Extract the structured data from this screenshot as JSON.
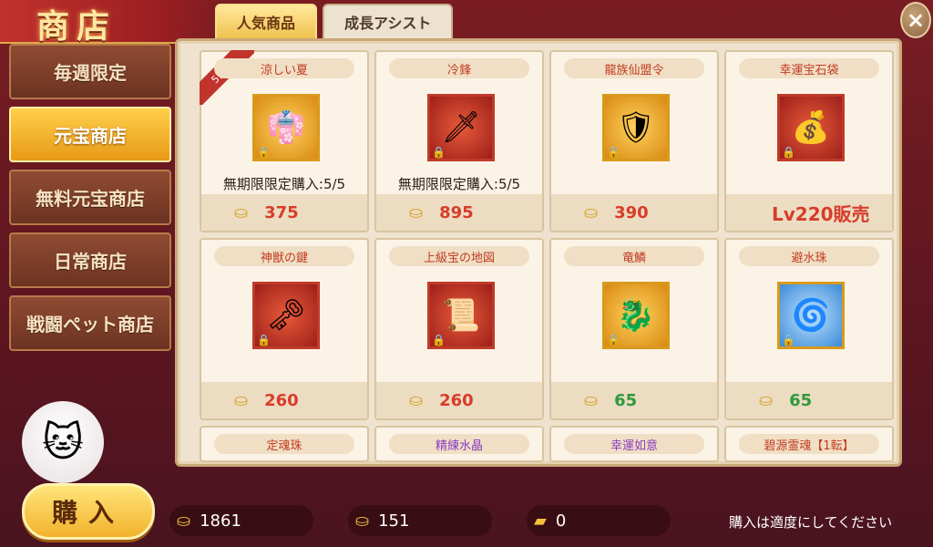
{
  "header": {
    "title": "商店",
    "close_label": "×"
  },
  "tabs": [
    {
      "label": "人気商品",
      "active": true
    },
    {
      "label": "成長アシスト",
      "active": false
    }
  ],
  "sidebar": {
    "items": [
      {
        "label": "毎週限定",
        "active": false
      },
      {
        "label": "元宝商店",
        "active": true
      },
      {
        "label": "無料元宝商店",
        "active": false
      },
      {
        "label": "日常商店",
        "active": false
      },
      {
        "label": "戦闘ペット商店",
        "active": false
      }
    ]
  },
  "products": [
    {
      "name": "涼しい夏",
      "limit": "無期限限定購入:5/5",
      "price": "375",
      "badge": "5割引",
      "icon": "blue-outfit-icon"
    },
    {
      "name": "冷鋒",
      "limit": "無期限限定購入:5/5",
      "price": "895",
      "icon": "sword-icon"
    },
    {
      "name": "龍族仙盟令",
      "price": "390",
      "icon": "token-icon"
    },
    {
      "name": "幸運宝石袋",
      "price": "Lv220販売",
      "icon": "gem-bag-icon"
    },
    {
      "name": "神獣の鍵",
      "price": "260",
      "icon": "key-icon"
    },
    {
      "name": "上級宝の地図",
      "price": "260",
      "icon": "map-icon"
    },
    {
      "name": "竜鱗",
      "price": "65",
      "icon": "dragon-scale-icon"
    },
    {
      "name": "避水珠",
      "price": "65",
      "icon": "water-orb-icon"
    },
    {
      "name": "定魂珠"
    },
    {
      "name": "精練水晶"
    },
    {
      "name": "幸運如意"
    },
    {
      "name": "碧源霊魂【1転】"
    }
  ],
  "footer": {
    "buy_label": "購入",
    "currency1": "1861",
    "currency2": "151",
    "currency3": "0",
    "hint": "購入は適度にしてください"
  },
  "colors": {
    "accent_gold": "#f2b22c",
    "price_red": "#d83c2a",
    "price_green": "#2f9a3b",
    "panel_bg": "#efe3cf"
  }
}
